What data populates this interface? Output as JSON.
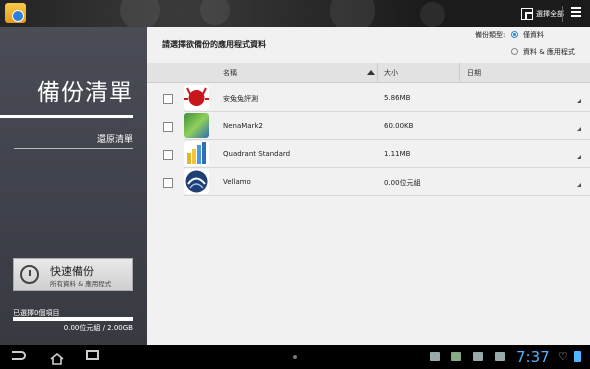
{
  "topbar": {
    "select_all": "選擇全部"
  },
  "sidebar": {
    "title": "備份清單",
    "restore": "還原清單",
    "quick_backup": {
      "label": "快速備份",
      "sub": "所有資料 & 應用程式"
    },
    "selected_count": "已選擇0個項目",
    "storage": "0.00位元組 / 2.00GB",
    "progress": 0
  },
  "main": {
    "prompt": "請選擇欲備份的應用程式資料",
    "backup_type": {
      "label": "備份類型:",
      "options": [
        {
          "label": "僅資料",
          "selected": true
        },
        {
          "label": "資料 & 應用程式",
          "selected": false
        }
      ]
    },
    "columns": {
      "name": "名稱",
      "size": "大小",
      "date": "日期"
    },
    "apps": [
      {
        "name": "安兔兔評測",
        "size": "5.86MB",
        "icon": "antutu-icon"
      },
      {
        "name": "NenaMark2",
        "size": "60.00KB",
        "icon": "nenamark-icon"
      },
      {
        "name": "Quadrant Standard",
        "size": "1.11MB",
        "icon": "quadrant-icon"
      },
      {
        "name": "Vellamo",
        "size": "0.00位元組",
        "icon": "vellamo-icon"
      }
    ]
  },
  "statusbar": {
    "time": "7:37"
  },
  "colors": {
    "accent": "#2a8cd8",
    "clock": "#4fb3ff",
    "sidebar": "#42454d"
  }
}
